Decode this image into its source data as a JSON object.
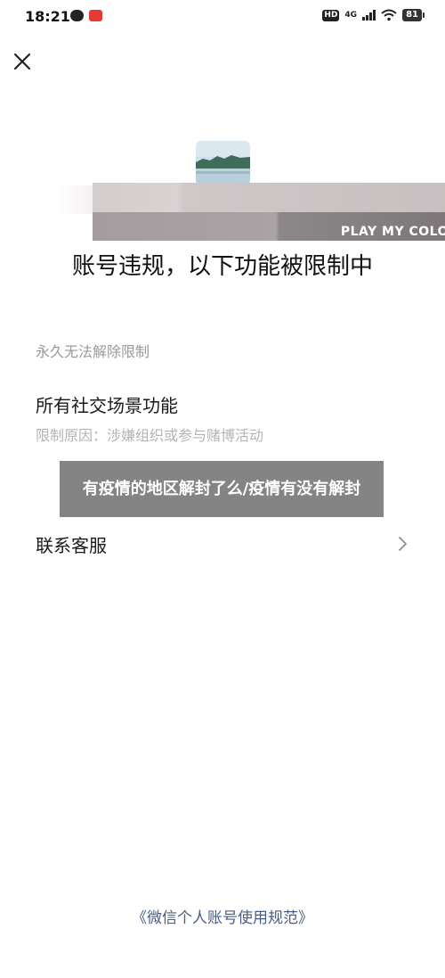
{
  "status_bar": {
    "time": "18:21",
    "hd_label": "HD",
    "network_label": "4G",
    "battery": "81"
  },
  "icons": {
    "close": "close-icon",
    "chevron": "chevron-right-icon"
  },
  "banner": {
    "text": "PLAY MY COLO"
  },
  "page": {
    "title": "账号违规，以下功能被限制中",
    "restriction_duration": "永久无法解除限制",
    "restricted_feature": "所有社交场景功能",
    "restriction_reason": "限制原因：涉嫌组织或参与赌博活动",
    "contact_label": "联系客服",
    "footer_link": "《微信个人账号使用规范》"
  },
  "overlay": {
    "caption": "有疫情的地区解封了么/疫情有没有解封"
  },
  "colors": {
    "link": "#4a5d83",
    "muted": "#9a9a9a",
    "overlay_bg": "#6e6e6e"
  }
}
